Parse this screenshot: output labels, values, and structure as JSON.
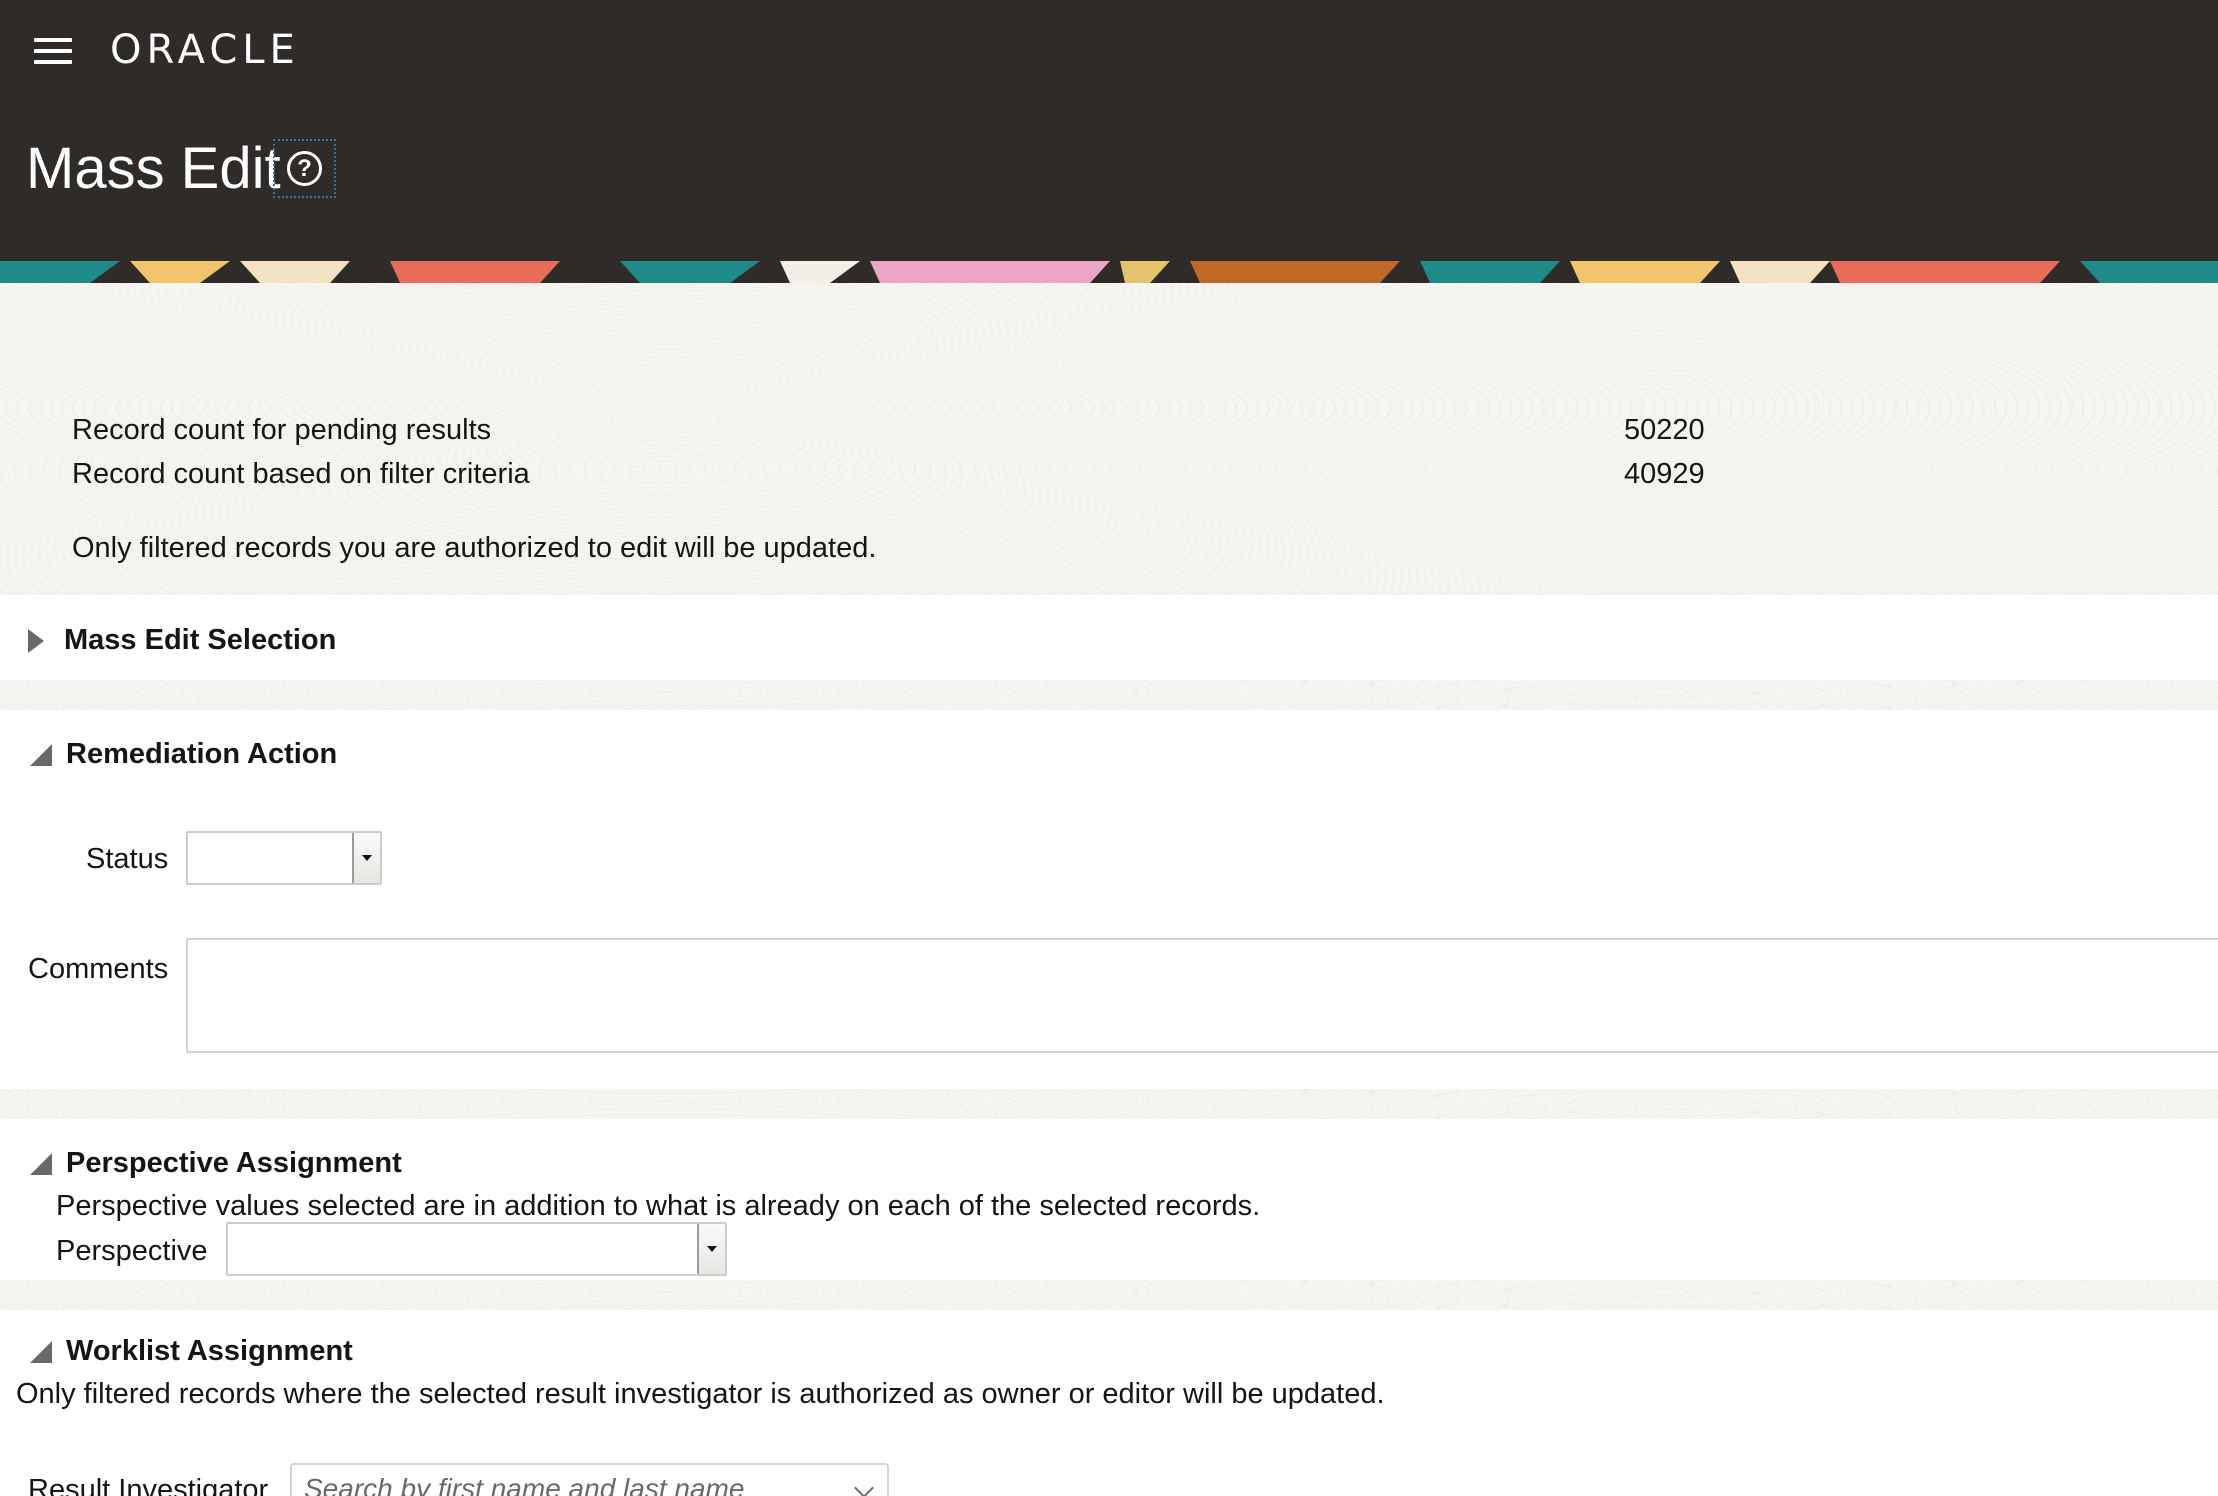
{
  "header": {
    "brand": "ORACLE",
    "title": "Mass Edit",
    "help_glyph": "?"
  },
  "summary": {
    "rows": [
      {
        "label": "Record count for pending results",
        "value": "50220"
      },
      {
        "label": "Record count based on filter criteria",
        "value": "40929"
      }
    ],
    "note": "Only filtered records you are authorized to edit will be updated."
  },
  "sections": {
    "mass_edit_selection": {
      "title": "Mass Edit Selection"
    },
    "remediation_action": {
      "title": "Remediation Action",
      "status_label": "Status",
      "status_value": "",
      "comments_label": "Comments",
      "comments_value": ""
    },
    "perspective_assignment": {
      "title": "Perspective Assignment",
      "description": "Perspective values selected are in addition to what is already on each of the selected records.",
      "perspective_label": "Perspective",
      "perspective_value": ""
    },
    "worklist_assignment": {
      "title": "Worklist Assignment",
      "description": "Only filtered records where the selected result investigator is authorized as owner or editor will be updated.",
      "investigator_label": "Result Investigator",
      "investigator_placeholder": "Search by first name and last name"
    }
  },
  "icons": {
    "menu": "hamburger-icon",
    "help": "help-icon",
    "collapsed": "triangle-right-icon",
    "expanded": "triangle-down-icon",
    "dropdown": "caret-down-icon",
    "combobox": "chevron-down-icon"
  },
  "colors": {
    "header_bg": "#2e2b28",
    "text": "#161513",
    "texture_bg": "#f7f5f2"
  }
}
